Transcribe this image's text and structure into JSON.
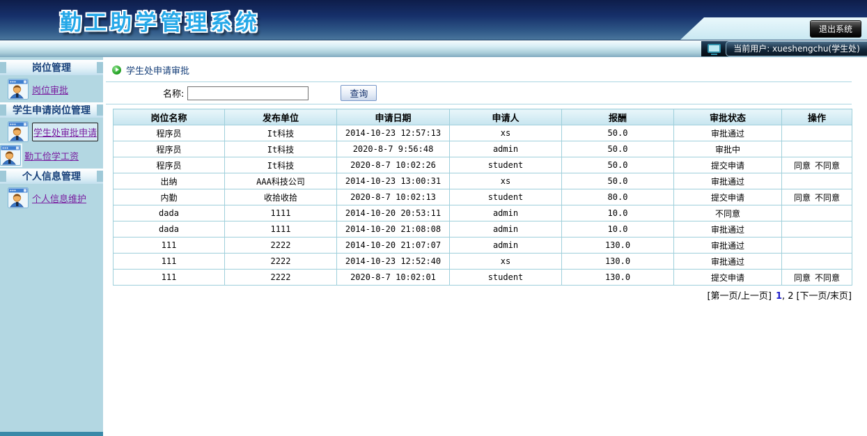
{
  "header": {
    "title": "勤工助学管理系统",
    "logout_label": "退出系统",
    "current_user": "当前用户: xueshengchu(学生处)"
  },
  "sidebar": {
    "sections": [
      {
        "title": "岗位管理",
        "items": [
          {
            "label": "岗位审批",
            "selected": false,
            "icon_offset": false
          }
        ]
      },
      {
        "title": "学生申请岗位管理",
        "items": [
          {
            "label": "学生处审批申请",
            "selected": true,
            "icon_offset": false
          },
          {
            "label": "勤工俭学工资",
            "selected": false,
            "icon_offset": true
          }
        ]
      },
      {
        "title": "个人信息管理",
        "items": [
          {
            "label": "个人信息维护",
            "selected": false,
            "icon_offset": false
          }
        ]
      }
    ]
  },
  "main": {
    "breadcrumb": "学生处申请审批",
    "search": {
      "label": "名称:",
      "value": "",
      "button": "查询"
    },
    "table": {
      "headers": [
        "岗位名称",
        "发布单位",
        "申请日期",
        "申请人",
        "报酬",
        "审批状态",
        "操作"
      ],
      "rows": [
        {
          "cells": [
            "程序员",
            "It科技",
            "2014-10-23 12:57:13",
            "xs",
            "50.0",
            "审批通过"
          ],
          "actions": []
        },
        {
          "cells": [
            "程序员",
            "It科技",
            "2020-8-7 9:56:48",
            "admin",
            "50.0",
            "审批中"
          ],
          "actions": []
        },
        {
          "cells": [
            "程序员",
            "It科技",
            "2020-8-7 10:02:26",
            "student",
            "50.0",
            "提交申请"
          ],
          "actions": [
            "同意",
            "不同意"
          ]
        },
        {
          "cells": [
            "出纳",
            "AAA科技公司",
            "2014-10-23 13:00:31",
            "xs",
            "50.0",
            "审批通过"
          ],
          "actions": []
        },
        {
          "cells": [
            "内勤",
            "收拾收拾",
            "2020-8-7 10:02:13",
            "student",
            "80.0",
            "提交申请"
          ],
          "actions": [
            "同意",
            "不同意"
          ]
        },
        {
          "cells": [
            "dada",
            "1111",
            "2014-10-20 20:53:11",
            "admin",
            "10.0",
            "不同意"
          ],
          "actions": []
        },
        {
          "cells": [
            "dada",
            "1111",
            "2014-10-20 21:08:08",
            "admin",
            "10.0",
            "审批通过"
          ],
          "actions": []
        },
        {
          "cells": [
            "111",
            "2222",
            "2014-10-20 21:07:07",
            "admin",
            "130.0",
            "审批通过"
          ],
          "actions": []
        },
        {
          "cells": [
            "111",
            "2222",
            "2014-10-23 12:52:40",
            "xs",
            "130.0",
            "审批通过"
          ],
          "actions": []
        },
        {
          "cells": [
            "111",
            "2222",
            "2020-8-7 10:02:01",
            "student",
            "130.0",
            "提交申请"
          ],
          "actions": [
            "同意",
            "不同意"
          ]
        }
      ]
    },
    "pagination": {
      "prev_group": "[第一页/上一页]",
      "current_page": "1",
      "separator": ",",
      "page_2": "2",
      "next_group": "[下一页/末页]"
    }
  },
  "colors": {
    "title_blue": "#25a8e8",
    "link_purple": "#7a1fa0",
    "sidebar_bg": "#b3d7e2",
    "table_border": "#9ecfdb",
    "nav_header_text": "#17407a",
    "current_page_blue": "#2222cc",
    "status_bar_bg": "#0a1826"
  }
}
